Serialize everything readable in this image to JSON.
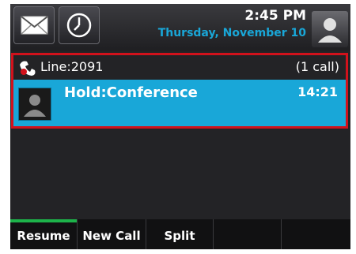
{
  "status_bar": {
    "time": "2:45 PM",
    "date": "Thursday, November 10",
    "icons": [
      "envelope-icon",
      "clock-icon",
      "user-avatar-icon"
    ]
  },
  "line": {
    "label": "Line:2091",
    "call_count": "(1 call)",
    "icon": "line-handset-icon",
    "accent_color": "#d1121c"
  },
  "call": {
    "name": "Hold:Conference",
    "timer": "14:21",
    "highlight_color": "#19a7d8"
  },
  "softkeys": [
    {
      "label": "Resume",
      "active": true
    },
    {
      "label": "New Call"
    },
    {
      "label": "Split"
    },
    {
      "label": ""
    },
    {
      "label": ""
    }
  ]
}
